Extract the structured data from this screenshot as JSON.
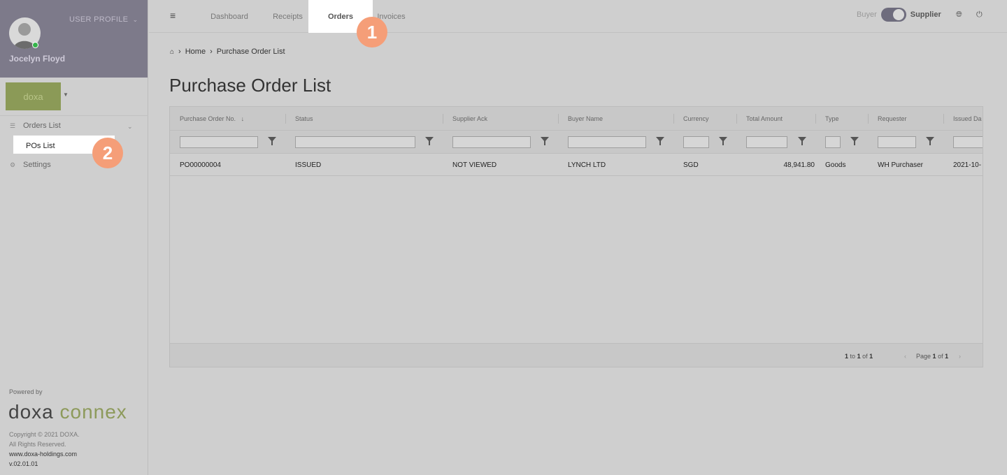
{
  "sidebar": {
    "user_profile_label": "USER PROFILE",
    "user_name": "Jocelyn Floyd",
    "brand_text": "doxa",
    "menu": {
      "orders_list": "Orders List",
      "pos_list": "POs List",
      "settings": "Settings"
    },
    "powered_by": "Powered by",
    "logo_part1": "doxa",
    "logo_part2": "connex",
    "copyright": "Copyright © 2021 DOXA.",
    "rights": "All Rights Reserved.",
    "website": "www.doxa-holdings.com",
    "version": "v.02.01.01"
  },
  "header": {
    "tabs": [
      "Dashboard",
      "Receipts",
      "Orders",
      "Invoices"
    ],
    "active_tab": "Orders",
    "switch_left": "Buyer",
    "switch_right": "Supplier"
  },
  "badges": [
    "1",
    "2"
  ],
  "breadcrumb": {
    "home": "Home",
    "current": "Purchase Order List"
  },
  "page_title": "Purchase Order List",
  "grid": {
    "columns": [
      "Purchase Order No.",
      "Status",
      "Supplier Ack",
      "Buyer Name",
      "Currency",
      "Total Amount",
      "Type",
      "Requester",
      "Issued Da"
    ],
    "rows": [
      [
        "PO00000004",
        "ISSUED",
        "NOT VIEWED",
        "LYNCH LTD",
        "SGD",
        "48,941.80",
        "Goods",
        "WH Purchaser",
        "2021-10-"
      ]
    ],
    "footer": {
      "range_from": "1",
      "range_to": "1",
      "range_total": "1",
      "to_word": "to",
      "of_word": "of",
      "page_word": "Page",
      "page_current": "1",
      "page_total": "1"
    }
  },
  "colors": {
    "sidebar_profile": "#7d7a8a",
    "brand_green": "#8b9a57",
    "badge": "#f59e78",
    "overlay_gray": "#cfcfcf"
  }
}
